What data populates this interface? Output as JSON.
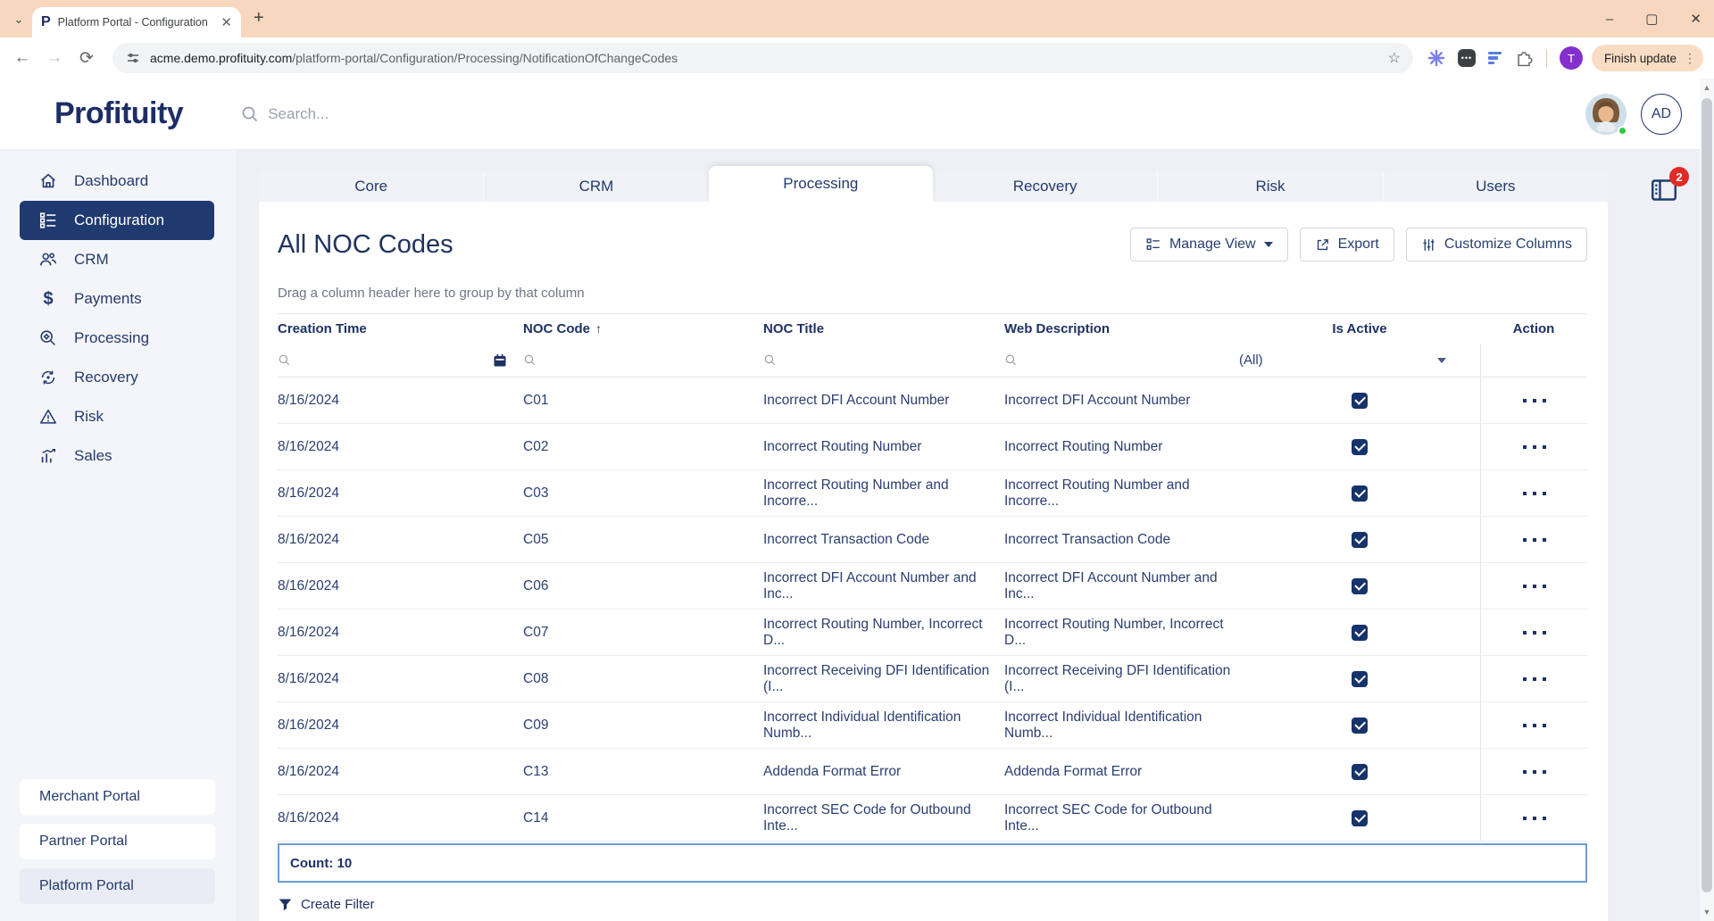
{
  "browser": {
    "tab_title": "Platform Portal - Configuration",
    "favicon_letter": "P",
    "url_domain": "acme.demo.profituity.com",
    "url_path": "/platform-portal/Configuration/Processing/NotificationOfChangeCodes",
    "profile_initial": "T",
    "update_button_label": "Finish update"
  },
  "header": {
    "logo_text": "Profituity",
    "search_placeholder": "Search...",
    "user_initials": "AD",
    "panel_badge_count": "2"
  },
  "sidebar": {
    "items": [
      {
        "label": "Dashboard",
        "active": false
      },
      {
        "label": "Configuration",
        "active": true
      },
      {
        "label": "CRM",
        "active": false
      },
      {
        "label": "Payments",
        "active": false
      },
      {
        "label": "Processing",
        "active": false
      },
      {
        "label": "Recovery",
        "active": false
      },
      {
        "label": "Risk",
        "active": false
      },
      {
        "label": "Sales",
        "active": false
      }
    ],
    "portal_links": [
      {
        "label": "Merchant Portal",
        "selected": false
      },
      {
        "label": "Partner Portal",
        "selected": false
      },
      {
        "label": "Platform Portal",
        "selected": true
      }
    ]
  },
  "module_tabs": [
    {
      "label": "Core",
      "active": false
    },
    {
      "label": "CRM",
      "active": false
    },
    {
      "label": "Processing",
      "active": true
    },
    {
      "label": "Recovery",
      "active": false
    },
    {
      "label": "Risk",
      "active": false
    },
    {
      "label": "Users",
      "active": false
    }
  ],
  "page": {
    "title": "All NOC Codes",
    "toolbar": {
      "manage_view_label": "Manage View",
      "export_label": "Export",
      "customize_columns_label": "Customize Columns"
    },
    "group_hint": "Drag a column header here to group by that column",
    "count_label": "Count: 10",
    "create_filter_label": "Create Filter"
  },
  "table": {
    "headers": {
      "creation_time": "Creation Time",
      "noc_code": "NOC Code",
      "sort_indicator": "↑",
      "noc_title": "NOC Title",
      "web_description": "Web Description",
      "is_active": "Is Active",
      "action": "Action"
    },
    "filters": {
      "is_active_value": "(All)"
    },
    "rows": [
      {
        "creation_time": "8/16/2024",
        "noc_code": "C01",
        "noc_title": "Incorrect DFI Account Number",
        "web_description": "Incorrect DFI Account Number",
        "is_active": true
      },
      {
        "creation_time": "8/16/2024",
        "noc_code": "C02",
        "noc_title": "Incorrect Routing Number",
        "web_description": "Incorrect Routing Number",
        "is_active": true
      },
      {
        "creation_time": "8/16/2024",
        "noc_code": "C03",
        "noc_title": "Incorrect Routing Number and Incorre...",
        "web_description": "Incorrect Routing Number and Incorre...",
        "is_active": true
      },
      {
        "creation_time": "8/16/2024",
        "noc_code": "C05",
        "noc_title": "Incorrect Transaction Code",
        "web_description": "Incorrect Transaction Code",
        "is_active": true
      },
      {
        "creation_time": "8/16/2024",
        "noc_code": "C06",
        "noc_title": "Incorrect DFI Account Number and Inc...",
        "web_description": "Incorrect DFI Account Number and Inc...",
        "is_active": true
      },
      {
        "creation_time": "8/16/2024",
        "noc_code": "C07",
        "noc_title": "Incorrect Routing Number, Incorrect D...",
        "web_description": "Incorrect Routing Number, Incorrect D...",
        "is_active": true
      },
      {
        "creation_time": "8/16/2024",
        "noc_code": "C08",
        "noc_title": "Incorrect Receiving DFI Identification (I...",
        "web_description": "Incorrect Receiving DFI Identification (I...",
        "is_active": true
      },
      {
        "creation_time": "8/16/2024",
        "noc_code": "C09",
        "noc_title": "Incorrect Individual Identification Numb...",
        "web_description": "Incorrect Individual Identification Numb...",
        "is_active": true
      },
      {
        "creation_time": "8/16/2024",
        "noc_code": "C13",
        "noc_title": "Addenda Format Error",
        "web_description": "Addenda Format Error",
        "is_active": true
      },
      {
        "creation_time": "8/16/2024",
        "noc_code": "C14",
        "noc_title": "Incorrect SEC Code for Outbound Inte...",
        "web_description": "Incorrect SEC Code for Outbound Inte...",
        "is_active": true
      }
    ]
  },
  "colors": {
    "navy": "#1f3a6e",
    "badge_red": "#e02b27",
    "count_border_blue": "#6b9cd6",
    "tabstrip_peach": "#f7d8bf",
    "profile_purple": "#8430ce",
    "status_green": "#2ecc40"
  }
}
